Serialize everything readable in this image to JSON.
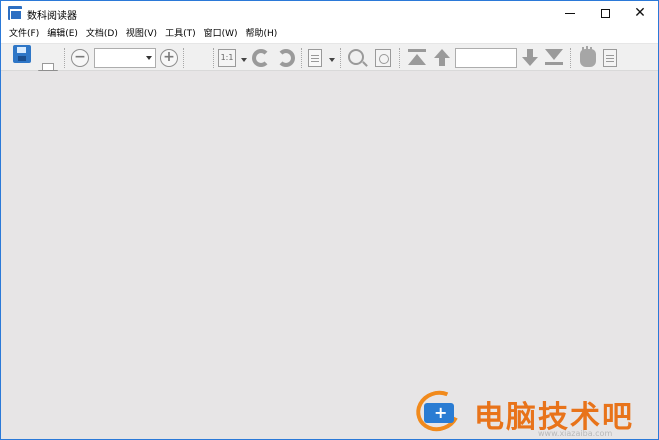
{
  "window": {
    "title": "数科阅读器"
  },
  "menu": {
    "items": [
      "文件(F)",
      "编辑(E)",
      "文档(D)",
      "视图(V)",
      "工具(T)",
      "窗口(W)",
      "帮助(H)"
    ]
  },
  "toolbar": {
    "zoom_value": "",
    "page_value": "",
    "zoom_out_glyph": "−",
    "zoom_in_glyph": "+",
    "actual_size_label": "1:1"
  },
  "icons": {
    "app": "app-icon",
    "save": "save-icon",
    "print": "print-icon",
    "zoom_out": "zoom-out-icon",
    "zoom_in": "zoom-in-icon",
    "fit": "monitor-icon",
    "rotate_cw": "rotate-clockwise-icon",
    "rotate_ccw": "rotate-counterclockwise-icon",
    "page_layout": "page-layout-icon",
    "magnifier": "magnifier-icon",
    "zoom_box": "zoom-box-icon",
    "first_page": "first-page-icon",
    "prev_page": "up-arrow-icon",
    "next_page": "down-arrow-icon",
    "last_page": "last-page-icon",
    "hand": "hand-icon",
    "select_text": "select-text-icon"
  },
  "colors": {
    "title_border": "#2b79d8",
    "document_background": "#e7e5e6",
    "toolbar_background": "#f0f0f0",
    "watermark_text": "#e8731a",
    "watermark_logo_blue": "#2a7cd3",
    "watermark_logo_orange": "#f18a1c"
  },
  "watermark": {
    "text": "电脑技术吧",
    "url": "www.xiazaiba.com"
  }
}
